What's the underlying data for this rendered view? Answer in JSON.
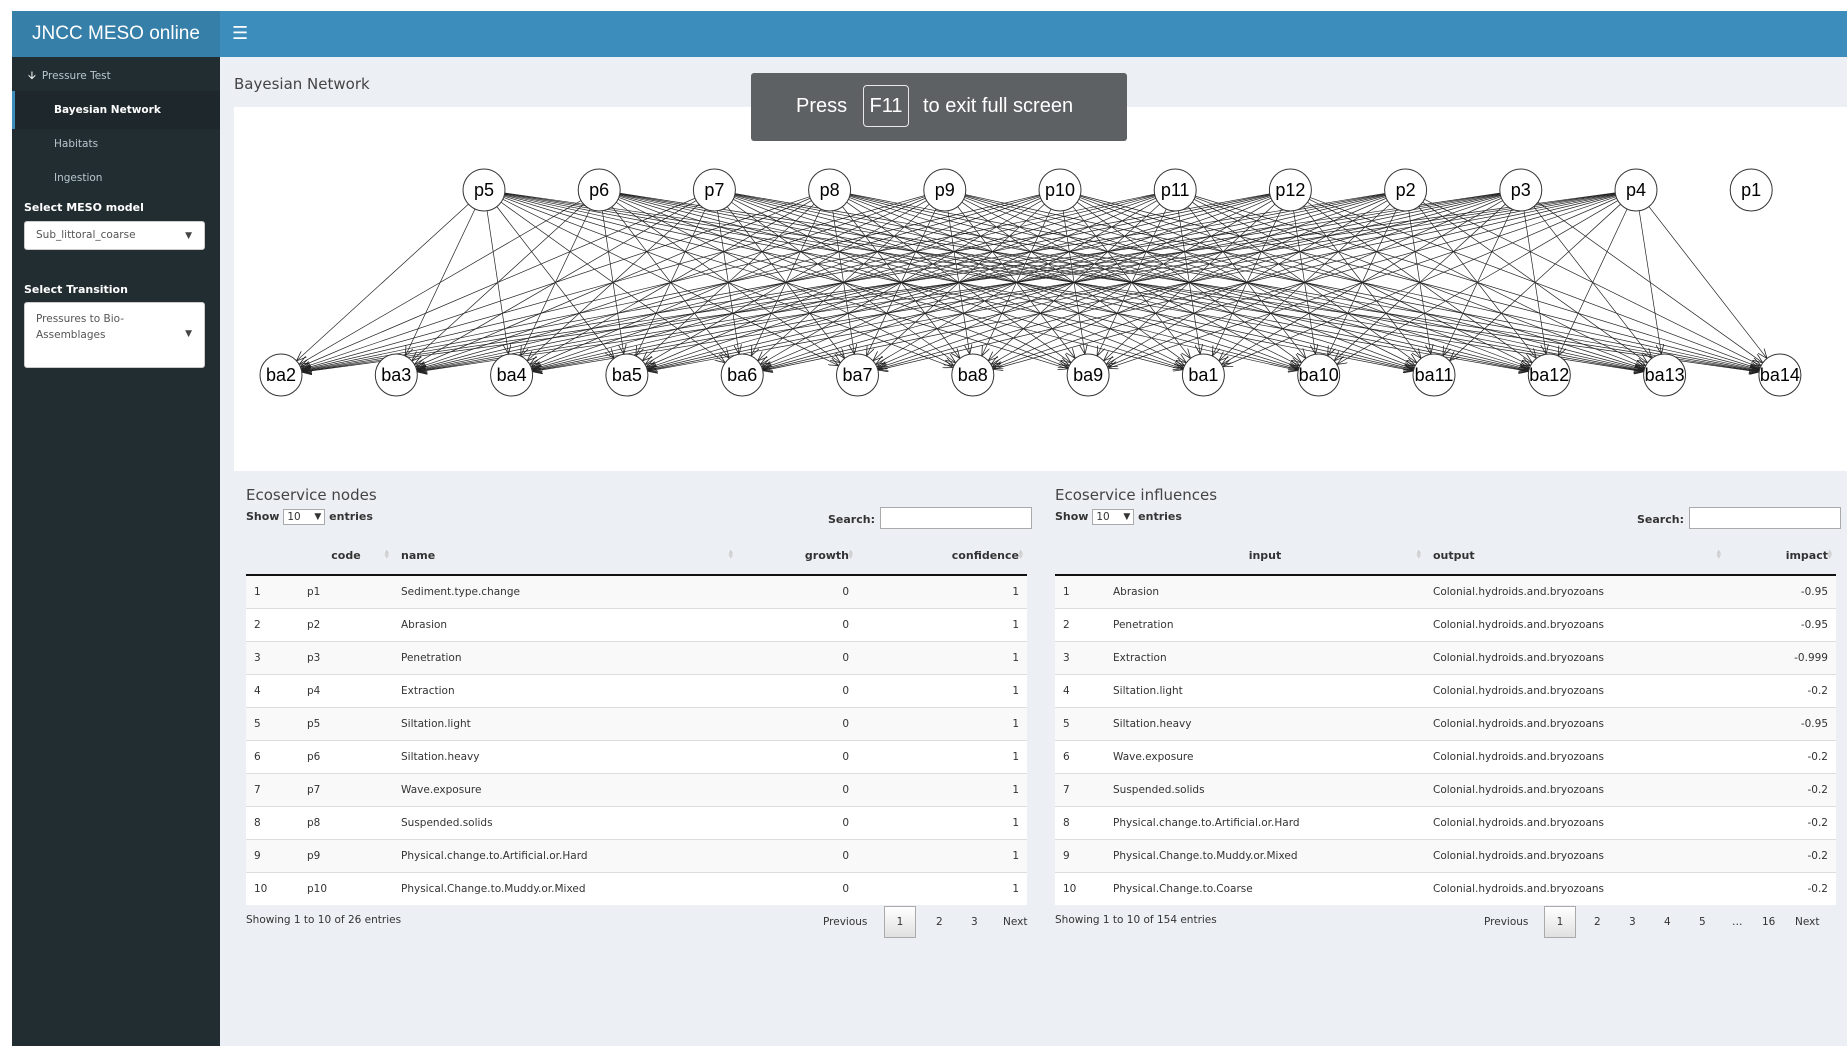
{
  "app": {
    "title": "JNCC MESO online"
  },
  "sidebar": {
    "items": [
      {
        "label": "Pressure Test",
        "icon": "arrow-down-icon"
      },
      {
        "label": "Bayesian Network"
      },
      {
        "label": "Habitats"
      },
      {
        "label": "Ingestion"
      }
    ],
    "model_label": "Select MESO model",
    "model_value": "Sub_littoral_coarse",
    "transition_label": "Select Transition",
    "transition_value": "Pressures to Bio-Assemblages"
  },
  "fullscreen_toast": {
    "before": "Press",
    "key": "F11",
    "after": "to exit full screen"
  },
  "graph": {
    "title": "Bayesian Network",
    "top_nodes": [
      "p5",
      "p6",
      "p7",
      "p8",
      "p9",
      "p10",
      "p11",
      "p12",
      "p2",
      "p3",
      "p4",
      "p1"
    ],
    "bottom_nodes": [
      "ba2",
      "ba3",
      "ba4",
      "ba5",
      "ba6",
      "ba7",
      "ba8",
      "ba9",
      "ba1",
      "ba10",
      "ba11",
      "ba12",
      "ba13",
      "ba14"
    ],
    "unconnected_node": "p1"
  },
  "nodes_table": {
    "title": "Ecoservice nodes",
    "show": "Show",
    "length": "10",
    "entries": "entries",
    "search_label": "Search:",
    "columns": [
      "",
      "code",
      "name",
      "growth",
      "confidence"
    ],
    "rows": [
      [
        "1",
        "p1",
        "Sediment.type.change",
        "0",
        "1"
      ],
      [
        "2",
        "p2",
        "Abrasion",
        "0",
        "1"
      ],
      [
        "3",
        "p3",
        "Penetration",
        "0",
        "1"
      ],
      [
        "4",
        "p4",
        "Extraction",
        "0",
        "1"
      ],
      [
        "5",
        "p5",
        "Siltation.light",
        "0",
        "1"
      ],
      [
        "6",
        "p6",
        "Siltation.heavy",
        "0",
        "1"
      ],
      [
        "7",
        "p7",
        "Wave.exposure",
        "0",
        "1"
      ],
      [
        "8",
        "p8",
        "Suspended.solids",
        "0",
        "1"
      ],
      [
        "9",
        "p9",
        "Physical.change.to.Artificial.or.Hard",
        "0",
        "1"
      ],
      [
        "10",
        "p10",
        "Physical.Change.to.Muddy.or.Mixed",
        "0",
        "1"
      ]
    ],
    "info": "Showing 1 to 10 of 26 entries",
    "pager": {
      "previous": "Previous",
      "pages": [
        "1",
        "2",
        "3"
      ],
      "next": "Next"
    }
  },
  "influence_table": {
    "title": "Ecoservice influences",
    "show": "Show",
    "length": "10",
    "entries": "entries",
    "search_label": "Search:",
    "columns": [
      "",
      "input",
      "output",
      "impact"
    ],
    "rows": [
      [
        "1",
        "Abrasion",
        "Colonial.hydroids.and.bryozoans",
        "-0.95"
      ],
      [
        "2",
        "Penetration",
        "Colonial.hydroids.and.bryozoans",
        "-0.95"
      ],
      [
        "3",
        "Extraction",
        "Colonial.hydroids.and.bryozoans",
        "-0.999"
      ],
      [
        "4",
        "Siltation.light",
        "Colonial.hydroids.and.bryozoans",
        "-0.2"
      ],
      [
        "5",
        "Siltation.heavy",
        "Colonial.hydroids.and.bryozoans",
        "-0.95"
      ],
      [
        "6",
        "Wave.exposure",
        "Colonial.hydroids.and.bryozoans",
        "-0.2"
      ],
      [
        "7",
        "Suspended.solids",
        "Colonial.hydroids.and.bryozoans",
        "-0.2"
      ],
      [
        "8",
        "Physical.change.to.Artificial.or.Hard",
        "Colonial.hydroids.and.bryozoans",
        "-0.2"
      ],
      [
        "9",
        "Physical.Change.to.Muddy.or.Mixed",
        "Colonial.hydroids.and.bryozoans",
        "-0.2"
      ],
      [
        "10",
        "Physical.Change.to.Coarse",
        "Colonial.hydroids.and.bryozoans",
        "-0.2"
      ]
    ],
    "info": "Showing 1 to 10 of 154 entries",
    "pager": {
      "previous": "Previous",
      "pages": [
        "1",
        "2",
        "3",
        "4",
        "5",
        "…",
        "16"
      ],
      "next": "Next"
    }
  }
}
